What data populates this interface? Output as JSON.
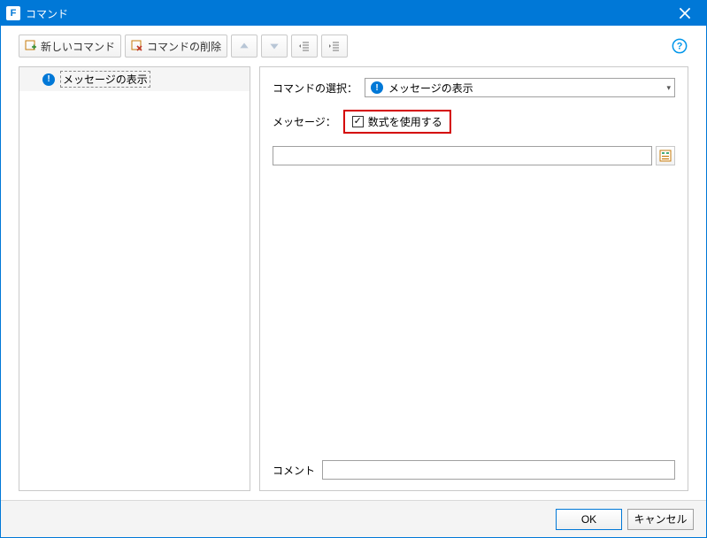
{
  "window": {
    "title": "コマンド"
  },
  "toolbar": {
    "new_command_label": "新しいコマンド",
    "delete_command_label": "コマンドの削除"
  },
  "tree": {
    "items": [
      {
        "label": "メッセージの表示"
      }
    ]
  },
  "editor": {
    "command_select_label": "コマンドの選択：",
    "command_select_value": "メッセージの表示",
    "message_label": "メッセージ：",
    "use_formula_label": "数式を使用する",
    "use_formula_checked": true,
    "message_value": "",
    "comment_label": "コメント",
    "comment_value": ""
  },
  "footer": {
    "ok_label": "OK",
    "cancel_label": "キャンセル"
  },
  "icons": {
    "help": "?"
  }
}
